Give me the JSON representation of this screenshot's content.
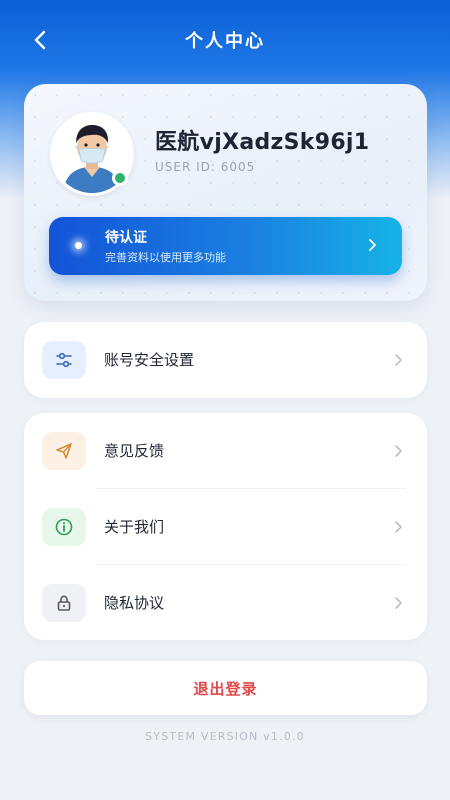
{
  "header": {
    "title": "个人中心"
  },
  "profile": {
    "username": "医航vjXadzSk96j1",
    "user_id": "USER ID: 6005"
  },
  "verify": {
    "title": "待认证",
    "subtitle": "完善资料以使用更多功能"
  },
  "menu_account": {
    "label": "账号安全设置",
    "icon": "sliders-icon"
  },
  "menu_group": [
    {
      "label": "意见反馈",
      "icon": "send-icon"
    },
    {
      "label": "关于我们",
      "icon": "info-icon"
    },
    {
      "label": "隐私协议",
      "icon": "lock-icon"
    }
  ],
  "logout": {
    "label": "退出登录"
  },
  "footer": {
    "version": "SYSTEM VERSION v1.0.0"
  },
  "colors": {
    "primary": "#1353d8",
    "danger": "#e0484a",
    "online": "#2db46a"
  }
}
